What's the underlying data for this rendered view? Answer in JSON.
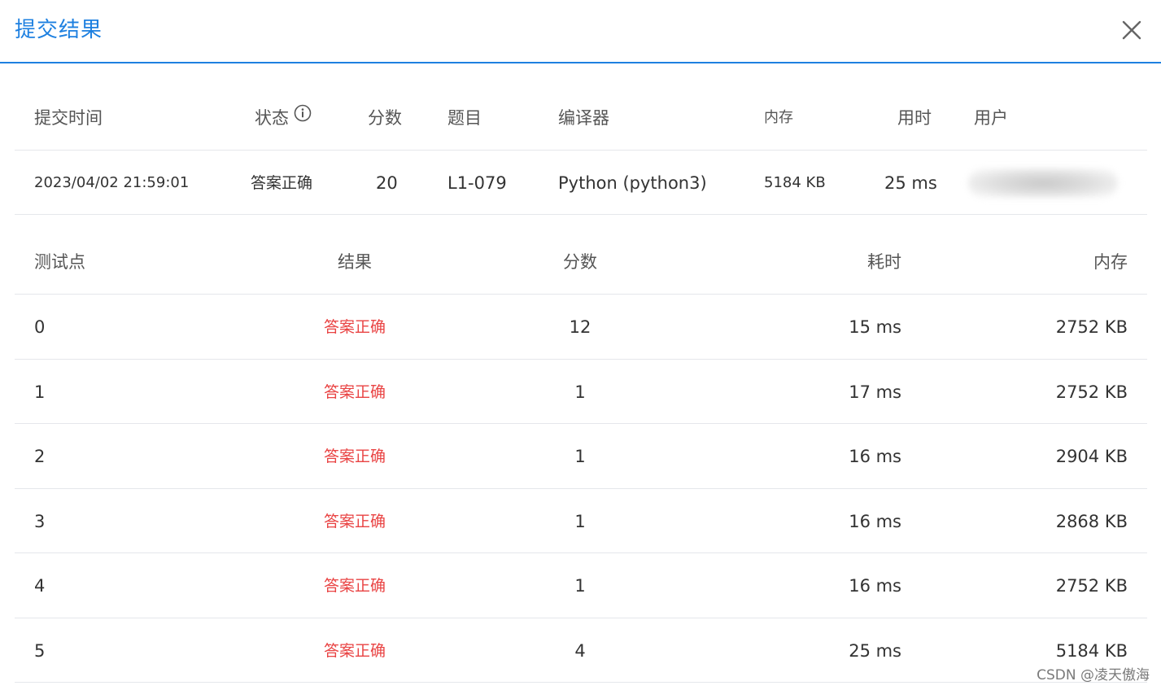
{
  "dialog": {
    "title": "提交结果",
    "close_icon": "close-icon"
  },
  "summary": {
    "headers": {
      "submit_time": "提交时间",
      "status": "状态",
      "score": "分数",
      "problem": "题目",
      "compiler": "编译器",
      "memory": "内存",
      "time": "用时",
      "user": "用户"
    },
    "row": {
      "submit_time": "2023/04/02 21:59:01",
      "status": "答案正确",
      "score": "20",
      "problem": "L1-079",
      "compiler": "Python (python3)",
      "memory": "5184 KB",
      "time": "25 ms"
    }
  },
  "test_points": {
    "headers": {
      "index": "测试点",
      "result": "结果",
      "score": "分数",
      "time": "耗时",
      "memory": "内存"
    },
    "rows": [
      {
        "index": "0",
        "result": "答案正确",
        "score": "12",
        "time": "15 ms",
        "memory": "2752 KB"
      },
      {
        "index": "1",
        "result": "答案正确",
        "score": "1",
        "time": "17 ms",
        "memory": "2752 KB"
      },
      {
        "index": "2",
        "result": "答案正确",
        "score": "1",
        "time": "16 ms",
        "memory": "2904 KB"
      },
      {
        "index": "3",
        "result": "答案正确",
        "score": "1",
        "time": "16 ms",
        "memory": "2868 KB"
      },
      {
        "index": "4",
        "result": "答案正确",
        "score": "1",
        "time": "16 ms",
        "memory": "2752 KB"
      },
      {
        "index": "5",
        "result": "答案正确",
        "score": "4",
        "time": "25 ms",
        "memory": "5184 KB"
      }
    ]
  },
  "watermark": "CSDN @凌天傲海",
  "colors": {
    "accent": "#1e80e0",
    "success_text": "#e94343",
    "divider": "#e5e7eb"
  }
}
